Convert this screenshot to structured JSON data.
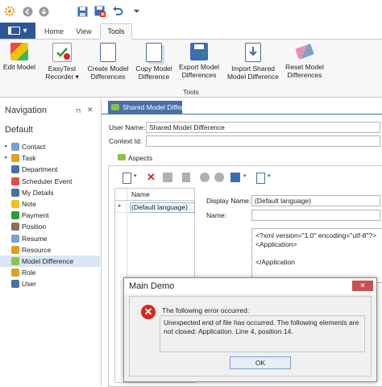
{
  "quick_access": {
    "icons": [
      "gear-icon",
      "back-icon",
      "refresh-icon",
      "save-icon",
      "save-close-icon",
      "undo-icon",
      "customize-arrow-icon"
    ]
  },
  "ribbon_tabs": {
    "file_icon": "window-icon",
    "home": "Home",
    "view": "View",
    "tools": "Tools"
  },
  "ribbon": {
    "group_label": "Tools",
    "buttons": [
      {
        "line1": "Edit Model",
        "line2": ""
      },
      {
        "line1": "EasyTest",
        "line2": "Recorder ▾"
      },
      {
        "line1": "Create Model",
        "line2": "Differences"
      },
      {
        "line1": "Copy Model",
        "line2": "Difference"
      },
      {
        "line1": "Export Model",
        "line2": "Differences"
      },
      {
        "line1": "Import Shared",
        "line2": "Model Difference"
      },
      {
        "line1": "Reset Model",
        "line2": "Differences"
      }
    ]
  },
  "navigation": {
    "title": "Navigation",
    "group": "Default",
    "items": [
      {
        "label": "Contact",
        "expandable": true
      },
      {
        "label": "Task",
        "expandable": true
      },
      {
        "label": "Department",
        "expandable": false
      },
      {
        "label": "Scheduler Event",
        "expandable": false
      },
      {
        "label": "My Details",
        "expandable": false
      },
      {
        "label": "Note",
        "expandable": false
      },
      {
        "label": "Payment",
        "expandable": false
      },
      {
        "label": "Position",
        "expandable": false
      },
      {
        "label": "Resume",
        "expandable": false
      },
      {
        "label": "Resource",
        "expandable": false
      },
      {
        "label": "Model Difference",
        "expandable": false
      },
      {
        "label": "Role",
        "expandable": false
      },
      {
        "label": "User",
        "expandable": false
      }
    ],
    "selected": "Model Difference"
  },
  "document_tab": {
    "label": "Shared Model Differe"
  },
  "form": {
    "user_name_label": "User Name:",
    "user_name_value": "Shared Model Difference",
    "context_id_label": "Context Id:",
    "context_id_value": "",
    "aspects_label": "Aspects"
  },
  "aspects_grid": {
    "column_header": "Name",
    "rows": [
      "(Default language)"
    ]
  },
  "aspect_detail": {
    "display_name_label": "Display Name:",
    "display_name_value": "(Default language)",
    "name_label": "Name:",
    "name_value": "",
    "xml_lines": [
      "<?xml version=\"1.0\" encoding=\"utf-8\"?>",
      "<Application>",
      "",
      "</Application"
    ]
  },
  "dialog": {
    "title": "Main Demo",
    "close_label": "✕",
    "message": "The following error occurred:",
    "detail": "Unexpected end of file has occurred. The following elements are not closed: Application. Line 4, position 14.",
    "ok_label": "OK"
  },
  "colors": {
    "accent": "#2b5797",
    "error": "#d9261c",
    "selected_row": "#d9e6f5",
    "doc_tab": "#4a6fa5"
  }
}
